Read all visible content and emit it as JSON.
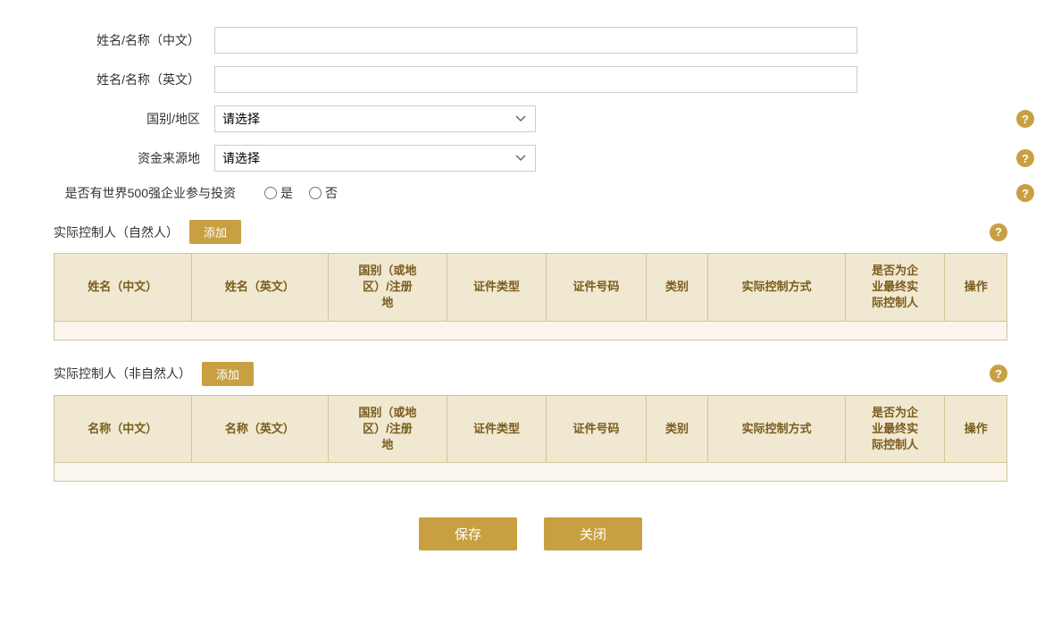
{
  "form": {
    "name_cn_label": "姓名/名称（中文）",
    "name_en_label": "姓名/名称（英文）",
    "country_label": "国别/地区",
    "country_placeholder": "请选择",
    "fund_source_label": "资金来源地",
    "fund_source_placeholder": "请选择",
    "fortune500_label": "是否有世界500强企业参与投资",
    "yes_label": "是",
    "no_label": "否"
  },
  "natural_person_section": {
    "title": "实际控制人（自然人）",
    "add_button": "添加",
    "columns": [
      "姓名（中文）",
      "姓名（英文）",
      "国别（或地区）/注册地",
      "证件类型",
      "证件号码",
      "类别",
      "实际控制方式",
      "是否为企业最终实际控制人",
      "操作"
    ]
  },
  "non_natural_person_section": {
    "title": "实际控制人（非自然人）",
    "add_button": "添加",
    "columns": [
      "名称（中文）",
      "名称（英文）",
      "国别（或地区）/注册地",
      "证件类型",
      "证件号码",
      "类别",
      "实际控制方式",
      "是否为企业最终实际控制人",
      "操作"
    ]
  },
  "buttons": {
    "save": "保存",
    "close": "关闭"
  },
  "help_icon": "?",
  "country_options": [
    {
      "value": "",
      "label": "请选择"
    }
  ],
  "fund_options": [
    {
      "value": "",
      "label": "请选择"
    }
  ]
}
